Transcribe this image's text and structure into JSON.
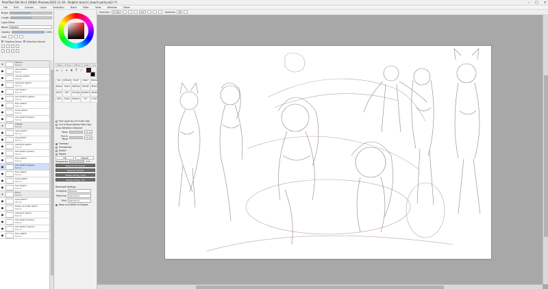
{
  "window": {
    "title": "PaintTool SAI Ver.2 (64bit) Preview.2022.11.30 - Dolphin bunch | beach party.sai2 (*)",
    "controls": [
      "–",
      "□",
      "×"
    ]
  },
  "menu": [
    "File",
    "Edit",
    "Canvas",
    "Layer",
    "Selection",
    "Ruler",
    "Filter",
    "View",
    "Window",
    "Other"
  ],
  "toolbar": {
    "selection_label": "Selection",
    "zoom": "17.5%",
    "angle": "0.0°",
    "stabilizer_label": "Stabilizer",
    "stabilizer_value": "15"
  },
  "layer_panel": {
    "blend_label": "Blend",
    "blend_value": "Normal",
    "opacity_label": "Opacity",
    "opacity_value": "100%",
    "opacity_fraction": 1.0,
    "lock_label": "Lock",
    "clipping_label": "Clipping Group",
    "selection_source_label": "Selection Source",
    "top_labels": [
      "Bright",
      "Length",
      "Layer Effect"
    ],
    "layers": [
      {
        "name": "Marisol",
        "sub": "Normal",
        "type": "folder"
      },
      {
        "name": "eyes sketch",
        "sub": "Normal",
        "type": "layer"
      },
      {
        "name": "canvas sketch",
        "sub": "Normal",
        "type": "layer"
      },
      {
        "name": "swimsuit sketch",
        "sub": "Normal",
        "type": "layer"
      },
      {
        "name": "hair sketch",
        "sub": "Normal",
        "type": "layer"
      },
      {
        "name": "hair sketch (upper)",
        "sub": "Normal",
        "type": "layer"
      },
      {
        "name": "face sketch",
        "sub": "Normal",
        "type": "layer"
      },
      {
        "name": "body sketch",
        "sub": "Normal",
        "type": "layer"
      },
      {
        "name": "hair sketch (lower)",
        "sub": "Normal",
        "type": "layer"
      },
      {
        "name": "Cassey",
        "sub": "Normal",
        "type": "folder"
      },
      {
        "name": "eyes sketch",
        "sub": "Normal",
        "type": "layer"
      },
      {
        "name": "bag sketch",
        "sub": "Normal",
        "type": "layer"
      },
      {
        "name": "swimsuit sketch",
        "sub": "Normal",
        "type": "layer"
      },
      {
        "name": "hair sketch (lower)",
        "sub": "Normal",
        "type": "layer"
      },
      {
        "name": "face sketch",
        "sub": "Normal",
        "type": "layer"
      },
      {
        "name": "hair sketch (upper)",
        "sub": "Normal",
        "type": "layer",
        "selected": true
      },
      {
        "name": "face sketch",
        "sub": "Normal",
        "type": "layer"
      },
      {
        "name": "body sketch",
        "sub": "Normal",
        "type": "layer"
      },
      {
        "name": "hair sketch",
        "sub": "Normal",
        "type": "layer"
      },
      {
        "name": "Fiona",
        "sub": "Normal",
        "type": "folder"
      },
      {
        "name": "eyes sketch",
        "sub": "Normal",
        "type": "layer"
      },
      {
        "name": "flower and ball sketch",
        "sub": "Normal",
        "type": "layer"
      },
      {
        "name": "swimsuit sketch",
        "sub": "Normal",
        "type": "layer"
      },
      {
        "name": "hair sketch (lower)",
        "sub": "Normal",
        "type": "layer"
      },
      {
        "name": "hair sketch (upper)",
        "sub": "Normal",
        "type": "layer"
      },
      {
        "name": "face sketch",
        "sub": "Normal",
        "type": "layer"
      }
    ]
  },
  "tool_panel": {
    "color_tabs": [
      "Wheel",
      "Slider",
      "Mixer",
      "Swatch",
      "Scratch"
    ],
    "colors": {
      "main": "#5a0a0a",
      "sub": "#000000"
    },
    "brushes": [
      "Pen",
      "AirBrush",
      "Brush",
      "Water",
      "Marker",
      "Eraser",
      "Select",
      "SelErase",
      "Bucket",
      "Binary",
      "Pencil",
      "Blur",
      "Smudge",
      "Gradation",
      "Shape",
      "Text",
      "Finger",
      "Sharpen",
      "Fill",
      "Lines"
    ],
    "checks": [
      {
        "label": "Pick Layer by Ctrl+Left Click",
        "on": false
      },
      {
        "label": "Ctrl & Move without Mod. Key",
        "on": false
      }
    ],
    "snap_label": "Snap Detection Distance",
    "move_label": "Move",
    "move_value": "10 px",
    "pick_label": "Pick & Move",
    "pick_value": "10 px",
    "transform_options": [
      {
        "label": "Freeform",
        "on": true
      },
      {
        "label": "Perspective",
        "on": false
      },
      {
        "label": "Distort",
        "on": false
      },
      {
        "label": "Rotate",
        "on": false
      }
    ],
    "ok_label": "OK",
    "cancel_label": "Cancel",
    "perspective_label": "Perspective",
    "perspective_value": "0 %",
    "dark_buttons": [
      "Reverse Horizontal",
      "Reverse Vertical",
      "Rotate 90deg. CCW",
      "Rotate 90deg. CW"
    ],
    "resample_label": "Resample Settings",
    "enlarging_label": "Enlarging",
    "enlarging_value": "Bilinear",
    "reducing_label": "Reducing",
    "reducing_value": "Lanczos 3",
    "final_label": "Final",
    "final_value": "Lanczos 3",
    "keep_line_label": "Keep Line Width of Shapes"
  }
}
